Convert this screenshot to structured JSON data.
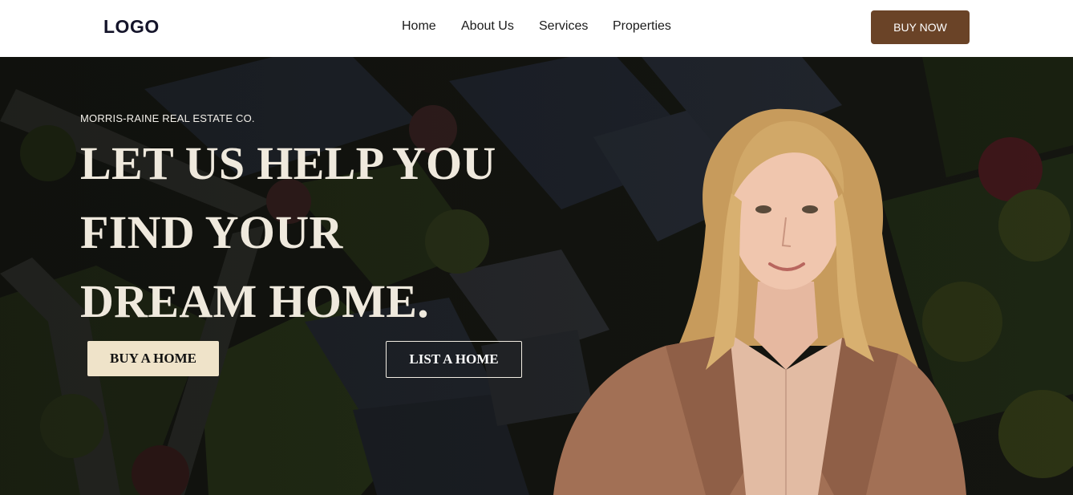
{
  "header": {
    "logo": "LOGO",
    "nav": [
      "Home",
      "About Us",
      "Services",
      "Properties"
    ],
    "cta": "BUY NOW"
  },
  "hero": {
    "eyebrow": "MORRIS-RAINE REAL ESTATE CO.",
    "headline_lines": [
      "LET US HELP YOU",
      "FIND YOUR",
      "DREAM HOME."
    ],
    "primary_button": "BUY A HOME",
    "secondary_button": "LIST A HOME"
  },
  "colors": {
    "brand_brown": "#6a4327",
    "cream_button": "#efe3c9",
    "headline_text": "#efe9dd",
    "hero_background": "#141511"
  }
}
